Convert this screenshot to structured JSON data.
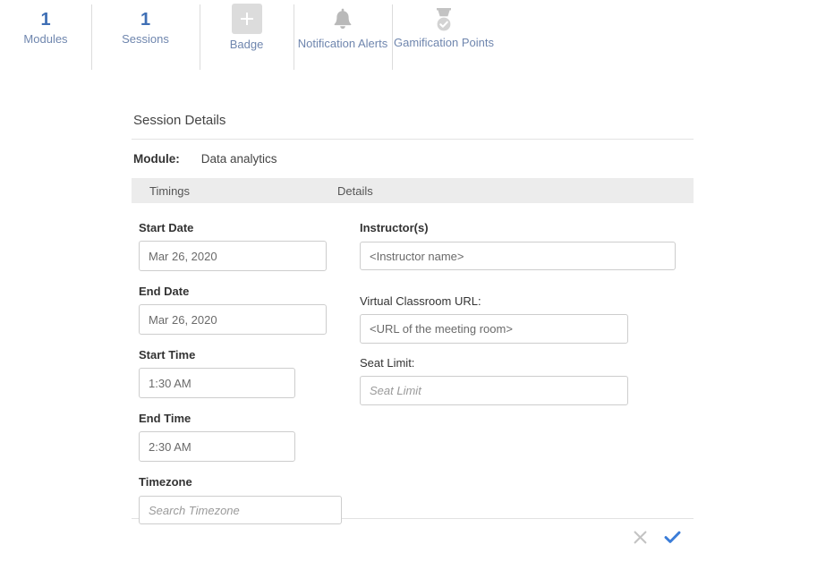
{
  "stat_bar": {
    "tabs": [
      {
        "count": "1",
        "label": "Modules",
        "icon": ""
      },
      {
        "count": "1",
        "label": "Sessions",
        "icon": ""
      },
      {
        "count": "",
        "label": "Badge",
        "icon": "plus-square-icon"
      },
      {
        "count": "",
        "label": "Notification Alerts",
        "icon": "bell-icon"
      },
      {
        "count": "",
        "label": "Gamification Points",
        "icon": "medal-check-icon"
      }
    ]
  },
  "panel": {
    "title": "Session Details",
    "module_label": "Module:",
    "module_value": "Data analytics",
    "columns": {
      "timings": "Timings",
      "details": "Details"
    },
    "fields_left": [
      {
        "label": "Start Date",
        "value": "Mar 26, 2020",
        "placeholder": ""
      },
      {
        "label": "End Date",
        "value": "Mar 26, 2020",
        "placeholder": ""
      },
      {
        "label": "Start Time",
        "value": "1:30 AM",
        "placeholder": ""
      },
      {
        "label": "End Time",
        "value": "2:30 AM",
        "placeholder": ""
      },
      {
        "label": "Timezone",
        "value": "",
        "placeholder": "Search Timezone"
      }
    ],
    "fields_right": [
      {
        "label": "Instructor(s)",
        "value": "<Instructor name>",
        "placeholder": ""
      },
      {
        "label": "Virtual Classroom URL:",
        "value": "<URL of the meeting room>",
        "placeholder": ""
      },
      {
        "label": "Seat Limit:",
        "value": "",
        "placeholder": "Seat Limit"
      }
    ],
    "actions": {
      "cancel": "cancel-icon",
      "confirm": "confirm-icon"
    }
  },
  "colors": {
    "count_blue": "#3f6fb5",
    "label_blue": "#6f86ae",
    "icon_gray": "#b9b9b9",
    "confirm_blue": "#3b7dd8",
    "cancel_gray": "#c3c3c3",
    "header_gray": "#ececec"
  }
}
